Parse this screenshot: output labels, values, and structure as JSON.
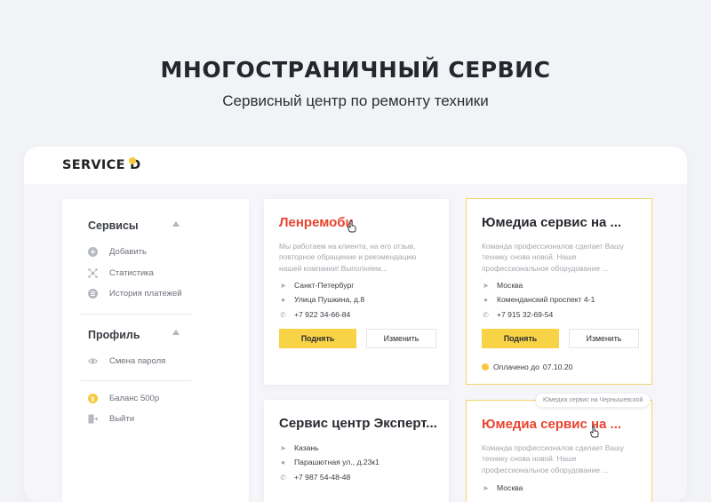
{
  "hero": {
    "title": "МНОГОСТРАНИЧНЫЙ СЕРВИС",
    "subtitle": "Сервисный центр по ремонту техники"
  },
  "app": {
    "logo": "SERVICE D",
    "accent_color": "#f7c93b",
    "red_color": "#e8442f"
  },
  "sidebar": {
    "services_heading": "Сервисы",
    "services_items": [
      {
        "label": "Добавить",
        "icon": "plus-circle-icon"
      },
      {
        "label": "Статистика",
        "icon": "network-icon"
      },
      {
        "label": "История платежей",
        "icon": "list-circle-icon"
      }
    ],
    "profile_heading": "Профиль",
    "profile_items": [
      {
        "label": "Смена пароля",
        "icon": "eye-icon"
      }
    ],
    "footer_items": [
      {
        "label": "Баланс 500р",
        "icon": "coin-icon"
      },
      {
        "label": "Выйти",
        "icon": "logout-icon"
      }
    ]
  },
  "cards": [
    {
      "title": "Ленремоби",
      "description": "Мы работаем на клиента, на его отзыв, повторное обращение и рекомендацию нашей компании! Выполняем...",
      "city": "Санкт-Петербург",
      "address": "Улица Пушкина, д.8",
      "phone": "+7 922 34-66-84",
      "raise_label": "Поднять",
      "edit_label": "Изменить"
    },
    {
      "title": "Юмедиа сервис на ...",
      "description": "Команда профессионалов сделает Вашу технику снова новой. Наше профессиональное оборудование ...",
      "city": "Москва",
      "address": "Комендaнский проспект 4-1",
      "phone": "+7 915 32-69-54",
      "raise_label": "Поднять",
      "edit_label": "Изменить",
      "paid_label": "Оплачено до",
      "paid_date": "07.10.20"
    },
    {
      "title": "Сервис центр Эксперт...",
      "city": "Казань",
      "address": "Парашютная ул., д.23к1",
      "phone": "+7 987 54-48-48"
    },
    {
      "title": "Юмедиа сервис на ...",
      "description": "Команда профессионалов сделает Вашу технику снова новой. Наше профессиональное оборудование ...",
      "city": "Москва",
      "tooltip": "Юмедиа сервис на Чернышевской"
    }
  ]
}
